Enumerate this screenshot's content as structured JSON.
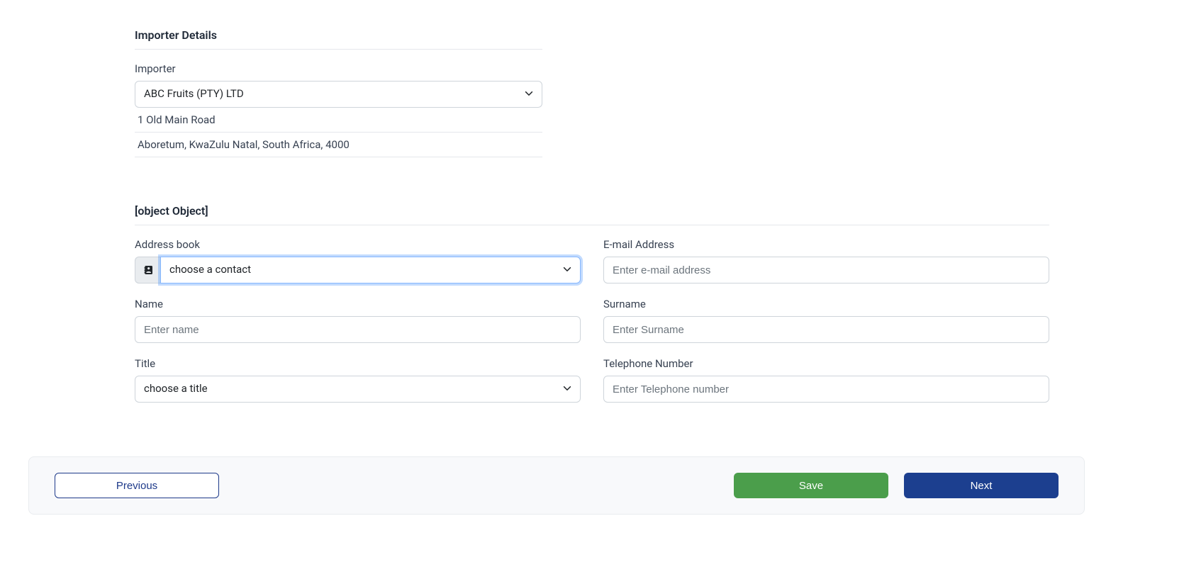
{
  "importer_section": {
    "title": "Importer Details",
    "label": "Importer",
    "selected": "ABC Fruits (PTY) LTD",
    "address_line1": "1 Old Main Road",
    "address_line2": "Aboretum, KwaZulu Natal, South Africa, 4000"
  },
  "notification_section": {
    "title": {
      "label": "Title",
      "selected": "choose a title"
    },
    "address_book": {
      "label": "Address book",
      "selected": "choose a contact"
    },
    "email": {
      "label": "E-mail Address",
      "placeholder": "Enter e-mail address",
      "value": ""
    },
    "name": {
      "label": "Name",
      "placeholder": "Enter name",
      "value": ""
    },
    "surname": {
      "label": "Surname",
      "placeholder": "Enter Surname",
      "value": ""
    },
    "telephone": {
      "label": "Telephone Number",
      "placeholder": "Enter Telephone number",
      "value": ""
    }
  },
  "footer": {
    "previous": "Previous",
    "save": "Save",
    "next": "Next"
  }
}
